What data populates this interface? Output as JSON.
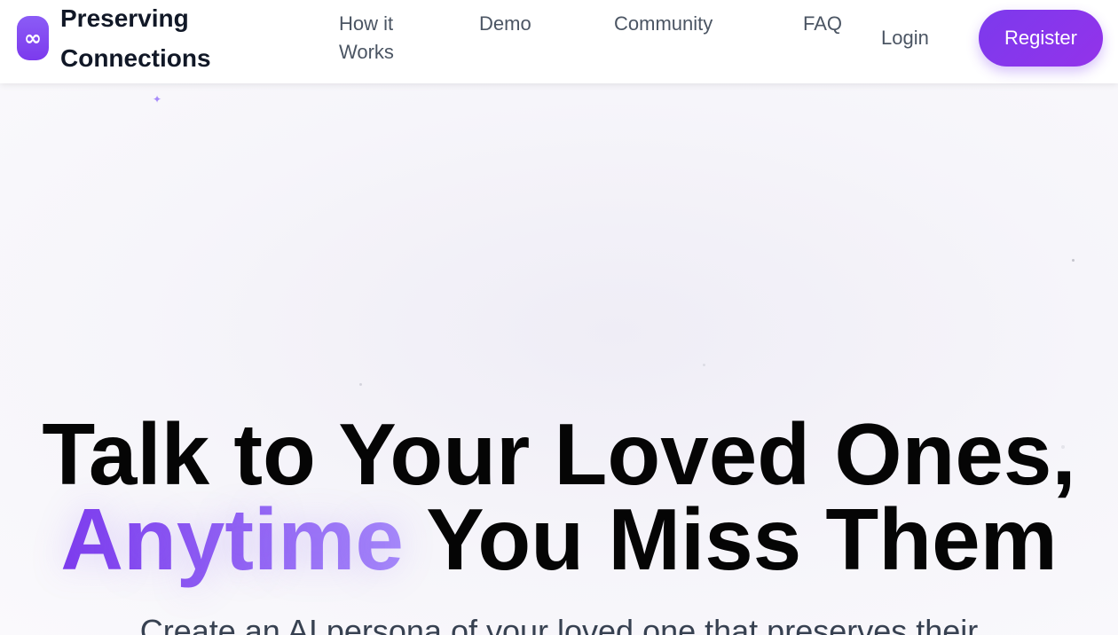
{
  "header": {
    "logo_glyph": "∞",
    "brand_name": "Preserving Connections",
    "nav": [
      {
        "label": "How it Works"
      },
      {
        "label": "Demo"
      },
      {
        "label": "Community"
      },
      {
        "label": "FAQ"
      }
    ],
    "login_label": "Login",
    "register_label": "Register"
  },
  "hero": {
    "headline_line1": "Talk to Your Loved Ones,",
    "headline_accent": "Anytime",
    "headline_rest": " You Miss Them",
    "subtitle": "Create an AI persona of your loved one that preserves their"
  },
  "colors": {
    "accent": "#7c3aed",
    "accent_light": "#a78bfa",
    "text_dark": "#050505",
    "nav_text": "#4b5563"
  }
}
